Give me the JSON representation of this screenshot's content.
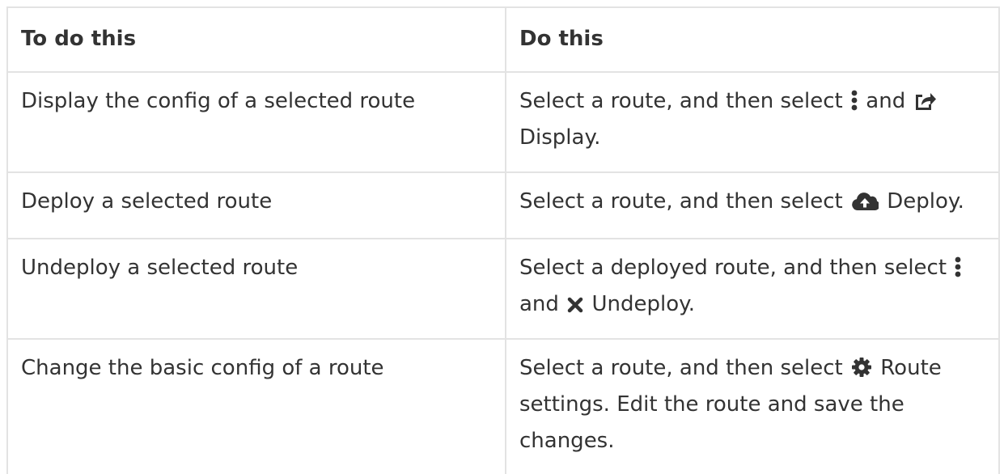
{
  "header": {
    "col1": "To do this",
    "col2": "Do this"
  },
  "rows": [
    {
      "task": "Display the config of a selected route",
      "action_pre": "Select a route, and then select",
      "action_mid": "and",
      "action_post": "Display."
    },
    {
      "task": "Deploy a selected route",
      "action_pre": "Select a route, and then select",
      "action_post": "Deploy."
    },
    {
      "task": "Undeploy a selected route",
      "action_pre": "Select a deployed route, and then select",
      "action_mid": "and",
      "action_post": "Undeploy."
    },
    {
      "task": "Change the basic config of a route",
      "action_pre": "Select a route, and then select",
      "action_post": "Route settings. Edit the route and save the changes."
    }
  ],
  "icons": {
    "kebab": "ellipsis-vertical-icon",
    "share": "share-square-icon",
    "cloud_upload": "cloud-upload-icon",
    "close": "close-icon",
    "gear": "gear-icon"
  },
  "colors": {
    "text": "#333333",
    "border": "#e3e3e3"
  }
}
